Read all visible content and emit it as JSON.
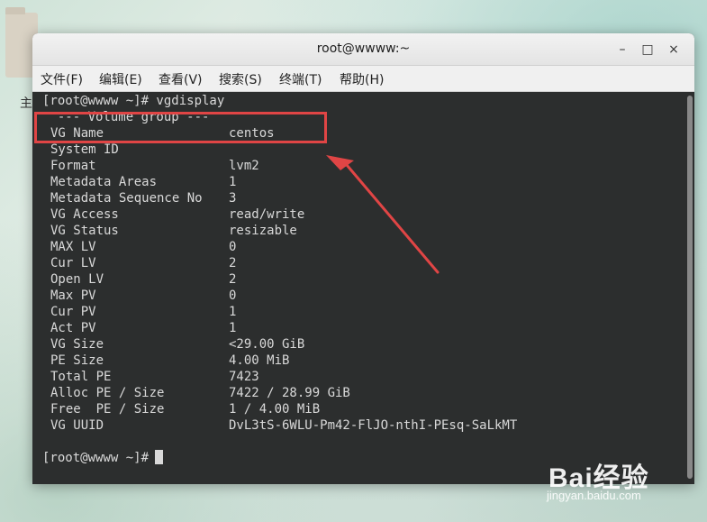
{
  "desktop": {
    "label": "主"
  },
  "window": {
    "title": "root@wwww:~",
    "controls": {
      "minimize": "–",
      "maximize": "□",
      "close": "×"
    }
  },
  "menubar": {
    "items": [
      {
        "label": "文件(F)"
      },
      {
        "label": "编辑(E)"
      },
      {
        "label": "查看(V)"
      },
      {
        "label": "搜索(S)"
      },
      {
        "label": "终端(T)"
      },
      {
        "label": "帮助(H)"
      }
    ]
  },
  "terminal": {
    "prompt_command": "[root@wwww ~]# vgdisplay",
    "header": "  --- Volume group ---",
    "rows": [
      {
        "label": "VG Name",
        "value": "centos"
      },
      {
        "label": "System ID",
        "value": ""
      },
      {
        "label": "Format",
        "value": "lvm2"
      },
      {
        "label": "Metadata Areas",
        "value": "1"
      },
      {
        "label": "Metadata Sequence No",
        "value": "3"
      },
      {
        "label": "VG Access",
        "value": "read/write"
      },
      {
        "label": "VG Status",
        "value": "resizable"
      },
      {
        "label": "MAX LV",
        "value": "0"
      },
      {
        "label": "Cur LV",
        "value": "2"
      },
      {
        "label": "Open LV",
        "value": "2"
      },
      {
        "label": "Max PV",
        "value": "0"
      },
      {
        "label": "Cur PV",
        "value": "1"
      },
      {
        "label": "Act PV",
        "value": "1"
      },
      {
        "label": "VG Size",
        "value": "<29.00 GiB"
      },
      {
        "label": "PE Size",
        "value": "4.00 MiB"
      },
      {
        "label": "Total PE",
        "value": "7423"
      },
      {
        "label": "Alloc PE / Size",
        "value": "7422 / 28.99 GiB"
      },
      {
        "label": "Free  PE / Size",
        "value": "1 / 4.00 MiB"
      },
      {
        "label": "VG UUID",
        "value": "DvL3tS-6WLU-Pm42-FlJO-nthI-PEsq-SaLkMT"
      }
    ],
    "final_prompt": "[root@wwww ~]# "
  },
  "watermark": {
    "brand": "Bai经验",
    "url": "jingyan.baidu.com"
  },
  "colors": {
    "terminal_bg": "#2c2e2e",
    "terminal_fg": "#d9d9d9",
    "highlight": "#e04545"
  }
}
